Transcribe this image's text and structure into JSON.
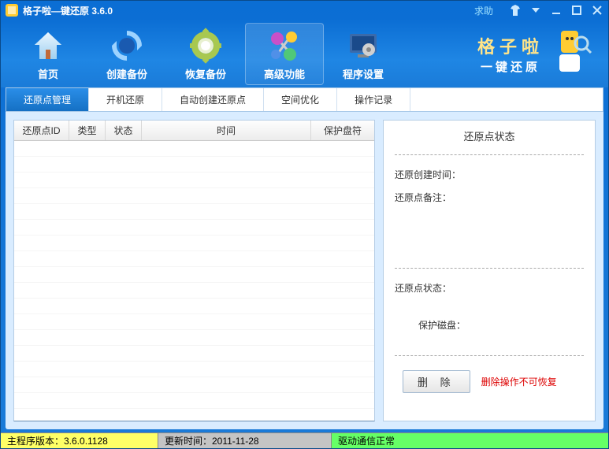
{
  "title": "格子啦—键还原 3.6.0",
  "help_link": "求助",
  "toolbar": [
    {
      "label": "首页"
    },
    {
      "label": "创建备份"
    },
    {
      "label": "恢复备份"
    },
    {
      "label": "高级功能"
    },
    {
      "label": "程序设置"
    }
  ],
  "brand": {
    "title": "格子啦",
    "sub": "一键还原"
  },
  "subtabs": [
    {
      "label": "还原点管理"
    },
    {
      "label": "开机还原"
    },
    {
      "label": "自动创建还原点"
    },
    {
      "label": "空间优化"
    },
    {
      "label": "操作记录"
    }
  ],
  "table": {
    "columns": [
      "还原点ID",
      "类型",
      "状态",
      "时间",
      "保护盘符"
    ],
    "rows": []
  },
  "status": {
    "title": "还原点状态",
    "create_time_label": "还原创建时间：",
    "remark_label": "还原点备注：",
    "status_label": "还原点状态：",
    "disk_label": "保护磁盘：",
    "delete_btn": "删 除",
    "warn": "删除操作不可恢复"
  },
  "statusbar": {
    "version": "主程序版本：3.6.0.1128",
    "update": "更新时间：2011-11-28",
    "driver": "驱动通信正常"
  }
}
